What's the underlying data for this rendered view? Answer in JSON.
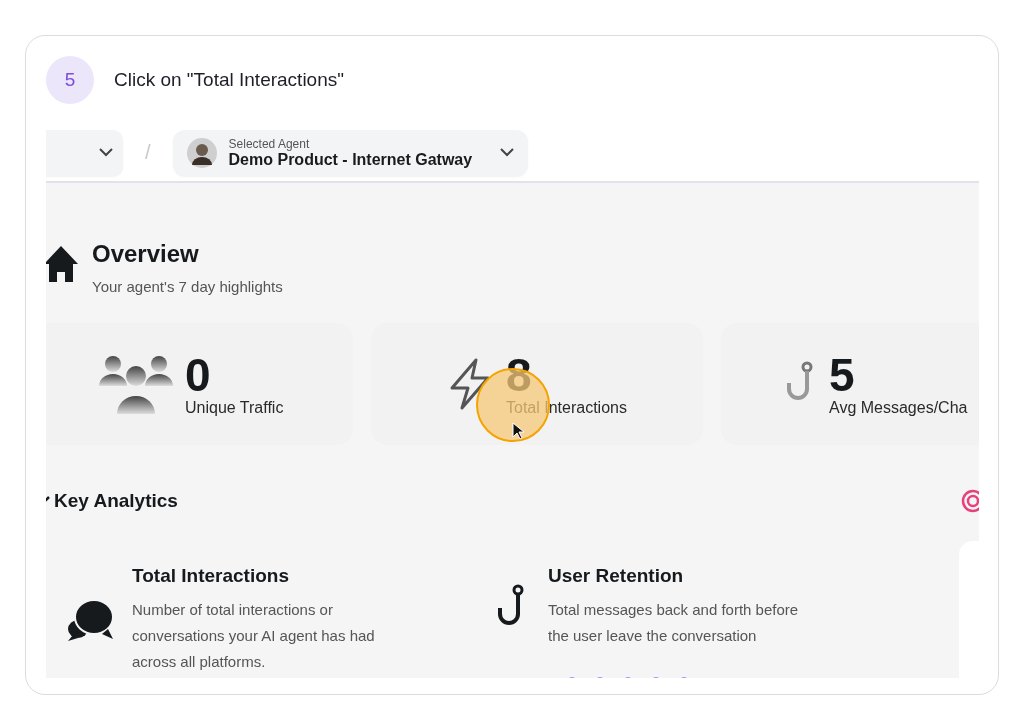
{
  "step": {
    "number": "5",
    "instruction": "Click on \"Total Interactions\""
  },
  "header": {
    "agent_label": "Selected Agent",
    "agent_name": "Demo Product - Internet Gatway",
    "separator": "/"
  },
  "overview": {
    "title": "Overview",
    "subtitle": "Your agent's 7 day highlights"
  },
  "stats": [
    {
      "kind": "people",
      "value": "0",
      "label": "Unique Traffic",
      "clicked": false
    },
    {
      "kind": "bolt",
      "value": "8",
      "label": "Total Interactions",
      "clicked": true
    },
    {
      "kind": "hook",
      "value": "5",
      "label": "Avg Messages/Cha",
      "clicked": false
    }
  ],
  "key_analytics": {
    "title": "Key Analytics",
    "items": [
      {
        "kind": "chat",
        "title": "Total Interactions",
        "description": "Number of total interactions or conversations your AI agent has had across all platforms."
      },
      {
        "kind": "hook",
        "title": "User Retention",
        "description": "Total messages back and forth before the user leave the conversation"
      }
    ]
  }
}
